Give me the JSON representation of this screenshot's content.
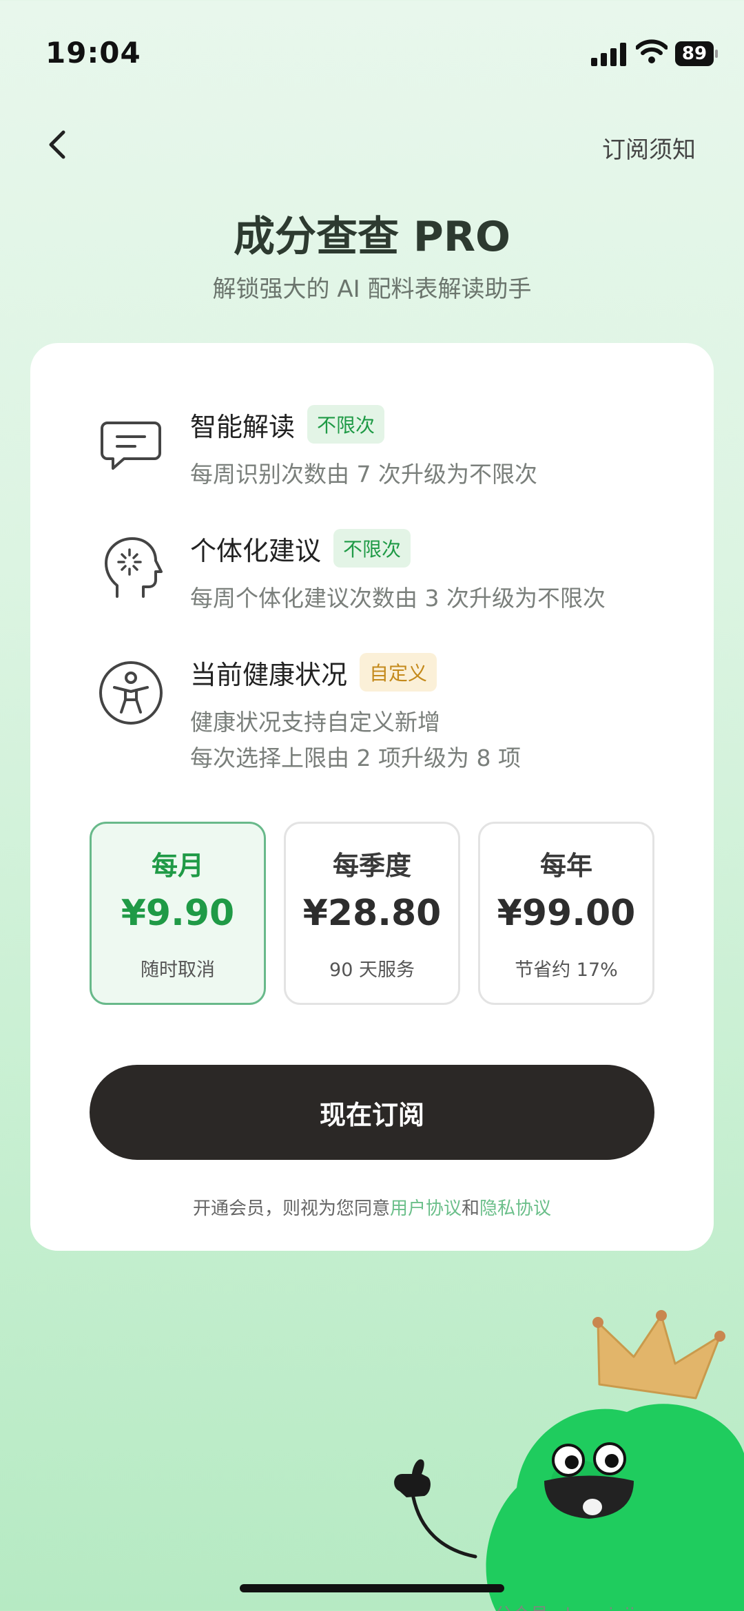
{
  "status_bar": {
    "time": "19:04",
    "battery": "89"
  },
  "nav": {
    "notice": "订阅须知"
  },
  "header": {
    "title": "成分查查 PRO",
    "subtitle": "解锁强大的 AI 配料表解读助手"
  },
  "features": [
    {
      "title": "智能解读",
      "badge": "不限次",
      "desc": "每周识别次数由 7 次升级为不限次",
      "icon": "chat-bubble-icon"
    },
    {
      "title": "个体化建议",
      "badge": "不限次",
      "desc": "每周个体化建议次数由 3 次升级为不限次",
      "icon": "head-idea-icon"
    },
    {
      "title": "当前健康状况",
      "badge": "自定义",
      "desc1": "健康状况支持自定义新增",
      "desc2": "每次选择上限由 2 项升级为 8 项",
      "icon": "accessibility-icon"
    }
  ],
  "plans": [
    {
      "name": "每月",
      "price": "¥9.90",
      "note": "随时取消",
      "selected": true
    },
    {
      "name": "每季度",
      "price": "¥28.80",
      "note": "90 天服务",
      "selected": false
    },
    {
      "name": "每年",
      "price": "¥99.00",
      "note": "节省约 17%",
      "selected": false
    }
  ],
  "cta": {
    "label": "现在订阅"
  },
  "agreement": {
    "prefix": "开通会员，则视为您同意",
    "user_terms": "用户协议",
    "and": "和",
    "privacy": "隐私协议"
  },
  "watermark": "公众号 · kanxinjiapo",
  "colors": {
    "accent": "#1f9a46",
    "button": "#2b2826",
    "badge_yellow": "#c48a1c",
    "mascot": "#22c55e"
  }
}
